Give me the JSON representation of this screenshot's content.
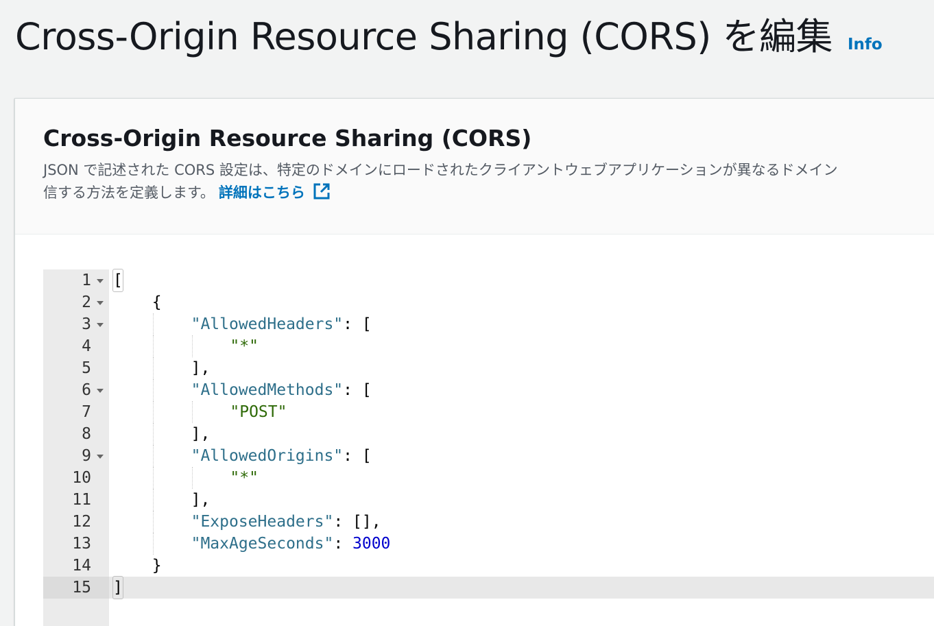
{
  "page": {
    "title": "Cross-Origin Resource Sharing (CORS) を編集",
    "info_label": "Info"
  },
  "panel": {
    "title": "Cross-Origin Resource Sharing (CORS)",
    "description_line1": "JSON で記述された CORS 設定は、特定のドメインにロードされたクライアントウェブアプリケーションが異なるドメイン",
    "description_line2": "信する方法を定義します。",
    "learn_more_label": "詳細はこちら",
    "learn_more_icon": "external-link-icon"
  },
  "editor": {
    "active_line": 15,
    "colors": {
      "key": "#2e6f8a",
      "string": "#2f6a08",
      "number": "#0000cd"
    },
    "lines": [
      {
        "n": "1",
        "fold": true
      },
      {
        "n": "2",
        "fold": true
      },
      {
        "n": "3",
        "fold": true,
        "key": "\"AllowedHeaders\"",
        "rest": ": ["
      },
      {
        "n": "4",
        "value": "\"*\""
      },
      {
        "n": "5",
        "text": "],"
      },
      {
        "n": "6",
        "fold": true,
        "key": "\"AllowedMethods\"",
        "rest": ": ["
      },
      {
        "n": "7",
        "value": "\"POST\""
      },
      {
        "n": "8",
        "text": "],"
      },
      {
        "n": "9",
        "fold": true,
        "key": "\"AllowedOrigins\"",
        "rest": ": ["
      },
      {
        "n": "10",
        "value": "\"*\""
      },
      {
        "n": "11",
        "text": "],"
      },
      {
        "n": "12",
        "key": "\"ExposeHeaders\"",
        "rest": ": [],"
      },
      {
        "n": "13",
        "key": "\"MaxAgeSeconds\"",
        "rest": ": ",
        "number": "3000"
      },
      {
        "n": "14",
        "text": "}"
      },
      {
        "n": "15",
        "text": "]"
      }
    ],
    "line1_text": "[",
    "line2_text": "{"
  }
}
